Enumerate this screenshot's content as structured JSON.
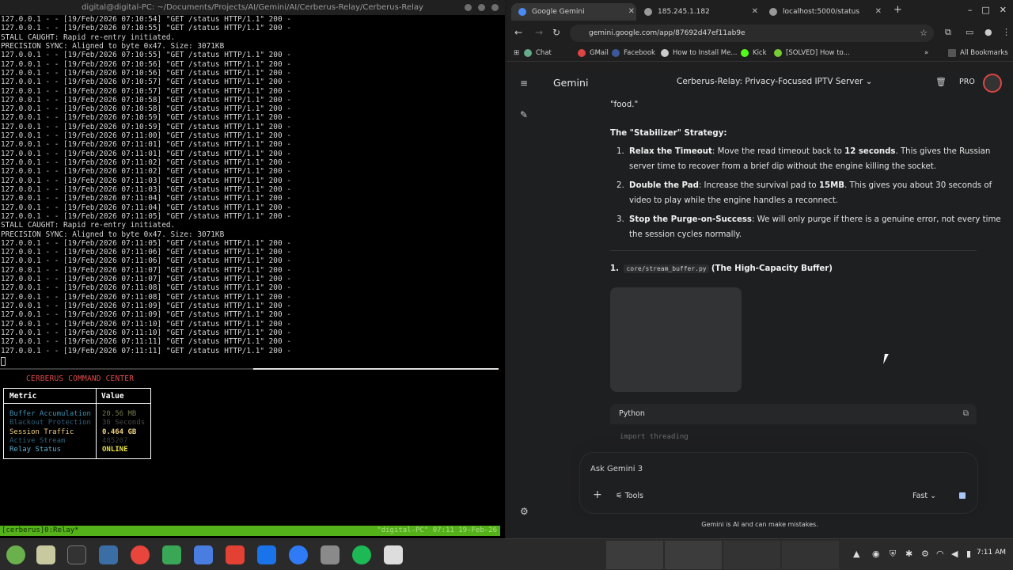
{
  "terminal": {
    "window_title": "digital@digital-PC: ~/Documents/Projects/AI/Gemini/AI/Cerberus-Relay/Cerberus-Relay",
    "log_lines": [
      "127.0.0.1 - - [19/Feb/2026 07:10:54] \"GET /status HTTP/1.1\" 200 -",
      "127.0.0.1 - - [19/Feb/2026 07:10:55] \"GET /status HTTP/1.1\" 200 -",
      "STALL CAUGHT: Rapid re-entry initiated.",
      "PRECISION SYNC: Aligned to byte 0x47. Size: 3071KB",
      "127.0.0.1 - - [19/Feb/2026 07:10:55] \"GET /status HTTP/1.1\" 200 -",
      "127.0.0.1 - - [19/Feb/2026 07:10:56] \"GET /status HTTP/1.1\" 200 -",
      "127.0.0.1 - - [19/Feb/2026 07:10:56] \"GET /status HTTP/1.1\" 200 -",
      "127.0.0.1 - - [19/Feb/2026 07:10:57] \"GET /status HTTP/1.1\" 200 -",
      "127.0.0.1 - - [19/Feb/2026 07:10:57] \"GET /status HTTP/1.1\" 200 -",
      "127.0.0.1 - - [19/Feb/2026 07:10:58] \"GET /status HTTP/1.1\" 200 -",
      "127.0.0.1 - - [19/Feb/2026 07:10:58] \"GET /status HTTP/1.1\" 200 -",
      "127.0.0.1 - - [19/Feb/2026 07:10:59] \"GET /status HTTP/1.1\" 200 -",
      "127.0.0.1 - - [19/Feb/2026 07:10:59] \"GET /status HTTP/1.1\" 200 -",
      "127.0.0.1 - - [19/Feb/2026 07:11:00] \"GET /status HTTP/1.1\" 200 -",
      "127.0.0.1 - - [19/Feb/2026 07:11:01] \"GET /status HTTP/1.1\" 200 -",
      "127.0.0.1 - - [19/Feb/2026 07:11:01] \"GET /status HTTP/1.1\" 200 -",
      "127.0.0.1 - - [19/Feb/2026 07:11:02] \"GET /status HTTP/1.1\" 200 -",
      "127.0.0.1 - - [19/Feb/2026 07:11:02] \"GET /status HTTP/1.1\" 200 -",
      "127.0.0.1 - - [19/Feb/2026 07:11:03] \"GET /status HTTP/1.1\" 200 -",
      "127.0.0.1 - - [19/Feb/2026 07:11:03] \"GET /status HTTP/1.1\" 200 -",
      "127.0.0.1 - - [19/Feb/2026 07:11:04] \"GET /status HTTP/1.1\" 200 -",
      "127.0.0.1 - - [19/Feb/2026 07:11:04] \"GET /status HTTP/1.1\" 200 -",
      "127.0.0.1 - - [19/Feb/2026 07:11:05] \"GET /status HTTP/1.1\" 200 -",
      "STALL CAUGHT: Rapid re-entry initiated.",
      "PRECISION SYNC: Aligned to byte 0x47. Size: 3071KB",
      "127.0.0.1 - - [19/Feb/2026 07:11:05] \"GET /status HTTP/1.1\" 200 -",
      "127.0.0.1 - - [19/Feb/2026 07:11:06] \"GET /status HTTP/1.1\" 200 -",
      "127.0.0.1 - - [19/Feb/2026 07:11:06] \"GET /status HTTP/1.1\" 200 -",
      "127.0.0.1 - - [19/Feb/2026 07:11:07] \"GET /status HTTP/1.1\" 200 -",
      "127.0.0.1 - - [19/Feb/2026 07:11:07] \"GET /status HTTP/1.1\" 200 -",
      "127.0.0.1 - - [19/Feb/2026 07:11:08] \"GET /status HTTP/1.1\" 200 -",
      "127.0.0.1 - - [19/Feb/2026 07:11:08] \"GET /status HTTP/1.1\" 200 -",
      "127.0.0.1 - - [19/Feb/2026 07:11:09] \"GET /status HTTP/1.1\" 200 -",
      "127.0.0.1 - - [19/Feb/2026 07:11:09] \"GET /status HTTP/1.1\" 200 -",
      "127.0.0.1 - - [19/Feb/2026 07:11:10] \"GET /status HTTP/1.1\" 200 -",
      "127.0.0.1 - - [19/Feb/2026 07:11:10] \"GET /status HTTP/1.1\" 200 -",
      "127.0.0.1 - - [19/Feb/2026 07:11:11] \"GET /status HTTP/1.1\" 200 -",
      "127.0.0.1 - - [19/Feb/2026 07:11:11] \"GET /status HTTP/1.1\" 200 -"
    ],
    "command_center": {
      "title": "CERBERUS COMMAND CENTER",
      "col_metric": "Metric",
      "col_value": "Value",
      "rows": [
        {
          "metric": "Buffer Accumulation",
          "value": "20.56 MB",
          "color": "#3f8fb0",
          "vcolor": "#6f7a4a"
        },
        {
          "metric": "Blackout Protection",
          "value": "36 Seconds",
          "color": "#2f5f7a",
          "vcolor": "#4a4a4a"
        },
        {
          "metric": "Session Traffic",
          "value": "0.464 GB",
          "color": "#f0d080",
          "vcolor": "#f0d080"
        },
        {
          "metric": "Active Stream",
          "value": "485207",
          "color": "#2f5f7a",
          "vcolor": "#3a3a3a"
        },
        {
          "metric": "Relay Status",
          "value": "ONLINE",
          "color": "#5fb0d0",
          "vcolor": "#e8e040"
        }
      ]
    },
    "statusbar_left": "[cerberus]0:Relay*",
    "statusbar_right": "\"digital-PC\" 07:11 19-Feb-26"
  },
  "browser": {
    "tabs": [
      {
        "label": "Google Gemini",
        "color": "#4a8af4"
      },
      {
        "label": "185.245.1.182",
        "color": "#aaaaaa"
      },
      {
        "label": "localhost:5000/status",
        "color": "#aaaaaa"
      }
    ],
    "url": "gemini.google.com/app/87692d47ef11ab9e",
    "bookmarks": [
      {
        "label": "Chat",
        "color": "#6a8"
      },
      {
        "label": "GMail",
        "color": "#d44"
      },
      {
        "label": "Facebook",
        "color": "#3b5998"
      },
      {
        "label": "How to Install Me...",
        "color": "#ccc"
      },
      {
        "label": "Kick",
        "color": "#53fc18"
      },
      {
        "label": "[SOLVED] How to...",
        "color": "#7c3"
      }
    ],
    "all_bookmarks": "All Bookmarks"
  },
  "gemini": {
    "brand": "Gemini",
    "conversation_title": "Cerberus-Relay: Privacy-Focused IPTV Server",
    "plan_badge": "PRO",
    "food": "\"food.\"",
    "strategy_heading": "The \"Stabilizer\" Strategy:",
    "items": [
      {
        "num": "1.",
        "bold": "Relax the Timeout",
        "text": ": Move the read timeout back to ",
        "bold2": "12 seconds",
        "text2": ". This gives the Russian",
        "line2": "server time to recover from a brief dip without the engine killing the socket."
      },
      {
        "num": "2.",
        "bold": "Double the Pad",
        "text": ": Increase the survival pad to ",
        "bold2": "15MB",
        "text2": ". This gives you about 30 seconds of",
        "line2": "video to play while the engine handles a reconnect."
      },
      {
        "num": "3.",
        "bold": "Stop the Purge-on-Success",
        "text": ": We will only purge if there is a genuine error, not every time",
        "bold2": "",
        "text2": "",
        "line2": "the session cycles normally."
      }
    ],
    "section_num": "1.",
    "section_code": "core/stream_buffer.py",
    "section_title": "(The High-Capacity Buffer)",
    "code_lang": "Python",
    "code_line": "import threading",
    "prompt_placeholder": "Ask Gemini 3",
    "tools_label": "Tools",
    "mode_label": "Fast",
    "disclaimer": "Gemini is AI and can make mistakes."
  },
  "taskbar": {
    "clock": "7:11 AM"
  }
}
